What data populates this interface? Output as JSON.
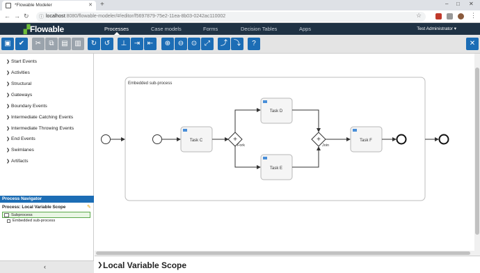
{
  "browser": {
    "tab_title": "*Flowable Modeler",
    "new_tab": "+",
    "url_host": "localhost",
    "url_rest": ":8080/flowable-modeler/#/editor/f5697879-75e2-11ea-8b03-0242ac110002"
  },
  "app": {
    "logo": "Flowable",
    "nav": [
      "Processes",
      "Case models",
      "Forms",
      "Decision Tables",
      "Apps"
    ],
    "active_nav": "Processes",
    "user": "Test Administrator"
  },
  "toolbar": {
    "icons": [
      "save-icon",
      "validate-icon",
      "cut-icon",
      "copy-icon",
      "paste-icon",
      "delete-icon",
      "redo-icon",
      "undo-icon",
      "align-icon",
      "bend-add-icon",
      "bend-remove-icon",
      "zoom-in-icon",
      "zoom-out-icon",
      "zoom-actual-icon",
      "zoom-fit-icon",
      "dock-icon",
      "dock-remove-icon",
      "help-icon",
      "close-icon"
    ]
  },
  "palette": {
    "items": [
      "Start Events",
      "Activities",
      "Structural",
      "Gateways",
      "Boundary Events",
      "Intermediate Catching Events",
      "Intermediate Throwing Events",
      "End Events",
      "Swimlanes",
      "Artifacts"
    ]
  },
  "navigator": {
    "header": "Process Navigator",
    "process_label": "Process: Local Variable Scope",
    "items": [
      "Subprocess",
      "Embedded sub-process"
    ]
  },
  "diagram": {
    "subprocess_label": "Embedded sub-process",
    "tasks": [
      "Task C",
      "Task D",
      "Task E",
      "Task F"
    ],
    "gateways": [
      "Fork",
      "Join"
    ]
  },
  "properties": {
    "title": "Local Variable Scope"
  },
  "colors": {
    "navbar": "#1f3244",
    "accent": "#1c6db5",
    "logo_green": "#6fbf3a"
  }
}
